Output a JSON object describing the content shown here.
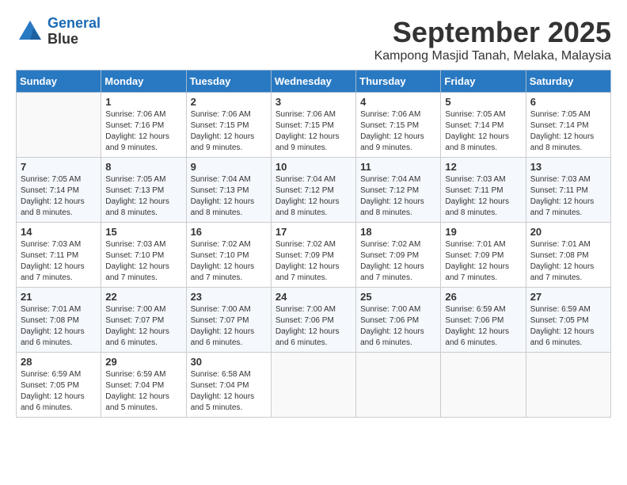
{
  "header": {
    "logo_line1": "General",
    "logo_line2": "Blue",
    "month": "September 2025",
    "location": "Kampong Masjid Tanah, Melaka, Malaysia"
  },
  "days_of_week": [
    "Sunday",
    "Monday",
    "Tuesday",
    "Wednesday",
    "Thursday",
    "Friday",
    "Saturday"
  ],
  "weeks": [
    [
      {
        "day": "",
        "info": ""
      },
      {
        "day": "1",
        "info": "Sunrise: 7:06 AM\nSunset: 7:16 PM\nDaylight: 12 hours\nand 9 minutes."
      },
      {
        "day": "2",
        "info": "Sunrise: 7:06 AM\nSunset: 7:15 PM\nDaylight: 12 hours\nand 9 minutes."
      },
      {
        "day": "3",
        "info": "Sunrise: 7:06 AM\nSunset: 7:15 PM\nDaylight: 12 hours\nand 9 minutes."
      },
      {
        "day": "4",
        "info": "Sunrise: 7:06 AM\nSunset: 7:15 PM\nDaylight: 12 hours\nand 9 minutes."
      },
      {
        "day": "5",
        "info": "Sunrise: 7:05 AM\nSunset: 7:14 PM\nDaylight: 12 hours\nand 8 minutes."
      },
      {
        "day": "6",
        "info": "Sunrise: 7:05 AM\nSunset: 7:14 PM\nDaylight: 12 hours\nand 8 minutes."
      }
    ],
    [
      {
        "day": "7",
        "info": "Sunrise: 7:05 AM\nSunset: 7:14 PM\nDaylight: 12 hours\nand 8 minutes."
      },
      {
        "day": "8",
        "info": "Sunrise: 7:05 AM\nSunset: 7:13 PM\nDaylight: 12 hours\nand 8 minutes."
      },
      {
        "day": "9",
        "info": "Sunrise: 7:04 AM\nSunset: 7:13 PM\nDaylight: 12 hours\nand 8 minutes."
      },
      {
        "day": "10",
        "info": "Sunrise: 7:04 AM\nSunset: 7:12 PM\nDaylight: 12 hours\nand 8 minutes."
      },
      {
        "day": "11",
        "info": "Sunrise: 7:04 AM\nSunset: 7:12 PM\nDaylight: 12 hours\nand 8 minutes."
      },
      {
        "day": "12",
        "info": "Sunrise: 7:03 AM\nSunset: 7:11 PM\nDaylight: 12 hours\nand 8 minutes."
      },
      {
        "day": "13",
        "info": "Sunrise: 7:03 AM\nSunset: 7:11 PM\nDaylight: 12 hours\nand 7 minutes."
      }
    ],
    [
      {
        "day": "14",
        "info": "Sunrise: 7:03 AM\nSunset: 7:11 PM\nDaylight: 12 hours\nand 7 minutes."
      },
      {
        "day": "15",
        "info": "Sunrise: 7:03 AM\nSunset: 7:10 PM\nDaylight: 12 hours\nand 7 minutes."
      },
      {
        "day": "16",
        "info": "Sunrise: 7:02 AM\nSunset: 7:10 PM\nDaylight: 12 hours\nand 7 minutes."
      },
      {
        "day": "17",
        "info": "Sunrise: 7:02 AM\nSunset: 7:09 PM\nDaylight: 12 hours\nand 7 minutes."
      },
      {
        "day": "18",
        "info": "Sunrise: 7:02 AM\nSunset: 7:09 PM\nDaylight: 12 hours\nand 7 minutes."
      },
      {
        "day": "19",
        "info": "Sunrise: 7:01 AM\nSunset: 7:09 PM\nDaylight: 12 hours\nand 7 minutes."
      },
      {
        "day": "20",
        "info": "Sunrise: 7:01 AM\nSunset: 7:08 PM\nDaylight: 12 hours\nand 7 minutes."
      }
    ],
    [
      {
        "day": "21",
        "info": "Sunrise: 7:01 AM\nSunset: 7:08 PM\nDaylight: 12 hours\nand 6 minutes."
      },
      {
        "day": "22",
        "info": "Sunrise: 7:00 AM\nSunset: 7:07 PM\nDaylight: 12 hours\nand 6 minutes."
      },
      {
        "day": "23",
        "info": "Sunrise: 7:00 AM\nSunset: 7:07 PM\nDaylight: 12 hours\nand 6 minutes."
      },
      {
        "day": "24",
        "info": "Sunrise: 7:00 AM\nSunset: 7:06 PM\nDaylight: 12 hours\nand 6 minutes."
      },
      {
        "day": "25",
        "info": "Sunrise: 7:00 AM\nSunset: 7:06 PM\nDaylight: 12 hours\nand 6 minutes."
      },
      {
        "day": "26",
        "info": "Sunrise: 6:59 AM\nSunset: 7:06 PM\nDaylight: 12 hours\nand 6 minutes."
      },
      {
        "day": "27",
        "info": "Sunrise: 6:59 AM\nSunset: 7:05 PM\nDaylight: 12 hours\nand 6 minutes."
      }
    ],
    [
      {
        "day": "28",
        "info": "Sunrise: 6:59 AM\nSunset: 7:05 PM\nDaylight: 12 hours\nand 6 minutes."
      },
      {
        "day": "29",
        "info": "Sunrise: 6:59 AM\nSunset: 7:04 PM\nDaylight: 12 hours\nand 5 minutes."
      },
      {
        "day": "30",
        "info": "Sunrise: 6:58 AM\nSunset: 7:04 PM\nDaylight: 12 hours\nand 5 minutes."
      },
      {
        "day": "",
        "info": ""
      },
      {
        "day": "",
        "info": ""
      },
      {
        "day": "",
        "info": ""
      },
      {
        "day": "",
        "info": ""
      }
    ]
  ]
}
